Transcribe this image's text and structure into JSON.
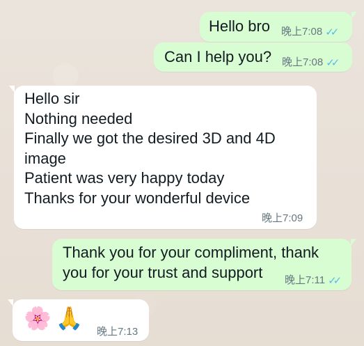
{
  "messages": [
    {
      "id": "m1",
      "direction": "outgoing",
      "text": "Hello bro",
      "time": "晚上7:08",
      "status_icon": "double-check-icon"
    },
    {
      "id": "m2",
      "direction": "outgoing",
      "text": "Can I help you?",
      "time": "晚上7:08",
      "status_icon": "double-check-icon"
    },
    {
      "id": "m3",
      "direction": "incoming",
      "text": "Hello sir\nNothing needed\nFinally we got the desired  3D and 4D\nimage\nPatient was very happy today\nThanks for your wonderful device",
      "time": "晚上7:09"
    },
    {
      "id": "m4",
      "direction": "outgoing",
      "text": "Thank you for your compliment, thank\nyou for your trust and support",
      "time": "晚上7:11",
      "status_icon": "double-check-icon"
    },
    {
      "id": "m5",
      "direction": "incoming",
      "emojis": [
        "🌸",
        "🙏"
      ],
      "time": "晚上7:13"
    }
  ],
  "colors": {
    "chat_background": "#ece5dd",
    "outgoing_bubble": "#d9fdd3",
    "incoming_bubble": "#ffffff",
    "timestamp": "#667781",
    "read_receipt": "#53bdeb"
  }
}
